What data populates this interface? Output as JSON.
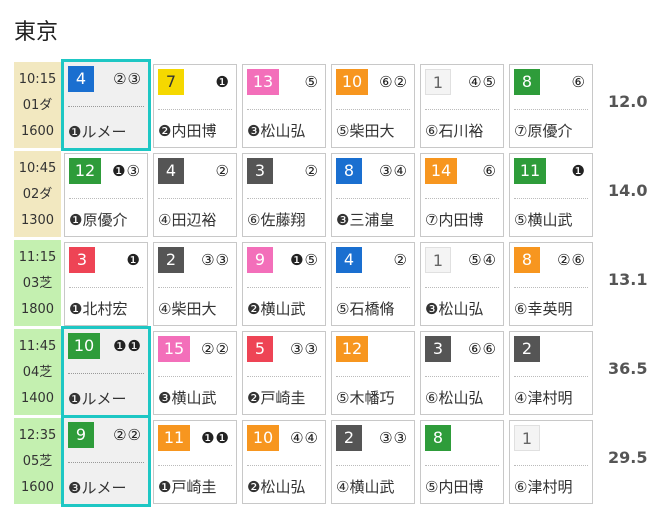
{
  "venue": "東京",
  "races": [
    {
      "time": "10:15",
      "no": "01ダ",
      "dist": "1600",
      "surface": "dirt",
      "odds": "12.0",
      "horses": [
        {
          "num": "4",
          "color": "b",
          "marks": "②③",
          "jockey": "❶ルメー",
          "hit": true
        },
        {
          "num": "7",
          "color": "y",
          "marks": "❶",
          "jockey": "❷内田博",
          "hit": false
        },
        {
          "num": "13",
          "color": "p",
          "marks": "⑤",
          "jockey": "❸松山弘",
          "hit": false
        },
        {
          "num": "10",
          "color": "o",
          "marks": "⑥②",
          "jockey": "⑤柴田大",
          "hit": false
        },
        {
          "num": "1",
          "color": "w",
          "marks": "④⑤",
          "jockey": "⑥石川裕",
          "hit": false
        },
        {
          "num": "8",
          "color": "g",
          "marks": "⑥",
          "jockey": "⑦原優介",
          "hit": false
        }
      ]
    },
    {
      "time": "10:45",
      "no": "02ダ",
      "dist": "1300",
      "surface": "dirt",
      "odds": "14.0",
      "horses": [
        {
          "num": "12",
          "color": "g",
          "marks": "❶③",
          "jockey": "❶原優介",
          "hit": false
        },
        {
          "num": "4",
          "color": "k",
          "marks": "②",
          "jockey": "④田辺裕",
          "hit": false
        },
        {
          "num": "3",
          "color": "k",
          "marks": "②",
          "jockey": "⑥佐藤翔",
          "hit": false
        },
        {
          "num": "8",
          "color": "b",
          "marks": "③④",
          "jockey": "❸三浦皇",
          "hit": false
        },
        {
          "num": "14",
          "color": "o",
          "marks": "⑥",
          "jockey": "⑦内田博",
          "hit": false
        },
        {
          "num": "11",
          "color": "g",
          "marks": "❶",
          "jockey": "⑤横山武",
          "hit": false
        }
      ]
    },
    {
      "time": "11:15",
      "no": "03芝",
      "dist": "1800",
      "surface": "turf",
      "odds": "13.1",
      "horses": [
        {
          "num": "3",
          "color": "r",
          "marks": "❶",
          "jockey": "❶北村宏",
          "hit": false
        },
        {
          "num": "2",
          "color": "k",
          "marks": "③③",
          "jockey": "④柴田大",
          "hit": false
        },
        {
          "num": "9",
          "color": "p",
          "marks": "❶⑤",
          "jockey": "❷横山武",
          "hit": false
        },
        {
          "num": "4",
          "color": "b",
          "marks": "②",
          "jockey": "⑤石橋脩",
          "hit": false
        },
        {
          "num": "1",
          "color": "w",
          "marks": "⑤④",
          "jockey": "❸松山弘",
          "hit": false
        },
        {
          "num": "8",
          "color": "o",
          "marks": "②⑥",
          "jockey": "⑥幸英明",
          "hit": false
        }
      ]
    },
    {
      "time": "11:45",
      "no": "04芝",
      "dist": "1400",
      "surface": "turf",
      "odds": "36.5",
      "horses": [
        {
          "num": "10",
          "color": "g",
          "marks": "❶❶",
          "jockey": "❶ルメー",
          "hit": true
        },
        {
          "num": "15",
          "color": "p",
          "marks": "②②",
          "jockey": "❸横山武",
          "hit": false
        },
        {
          "num": "5",
          "color": "r",
          "marks": "③③",
          "jockey": "❷戸崎圭",
          "hit": false
        },
        {
          "num": "12",
          "color": "o",
          "marks": "",
          "jockey": "⑤木幡巧",
          "hit": false
        },
        {
          "num": "3",
          "color": "k",
          "marks": "⑥⑥",
          "jockey": "⑥松山弘",
          "hit": false
        },
        {
          "num": "2",
          "color": "k",
          "marks": "",
          "jockey": "④津村明",
          "hit": false
        }
      ]
    },
    {
      "time": "12:35",
      "no": "05芝",
      "dist": "1600",
      "surface": "turf",
      "odds": "29.5",
      "horses": [
        {
          "num": "9",
          "color": "g",
          "marks": "②②",
          "jockey": "❸ルメー",
          "hit": true
        },
        {
          "num": "11",
          "color": "o",
          "marks": "❶❶",
          "jockey": "❶戸崎圭",
          "hit": false
        },
        {
          "num": "10",
          "color": "o",
          "marks": "④④",
          "jockey": "❷松山弘",
          "hit": false
        },
        {
          "num": "2",
          "color": "k",
          "marks": "③③",
          "jockey": "④横山武",
          "hit": false
        },
        {
          "num": "8",
          "color": "g",
          "marks": "",
          "jockey": "⑤内田博",
          "hit": false
        },
        {
          "num": "1",
          "color": "w",
          "marks": "",
          "jockey": "⑥津村明",
          "hit": false
        }
      ]
    }
  ]
}
